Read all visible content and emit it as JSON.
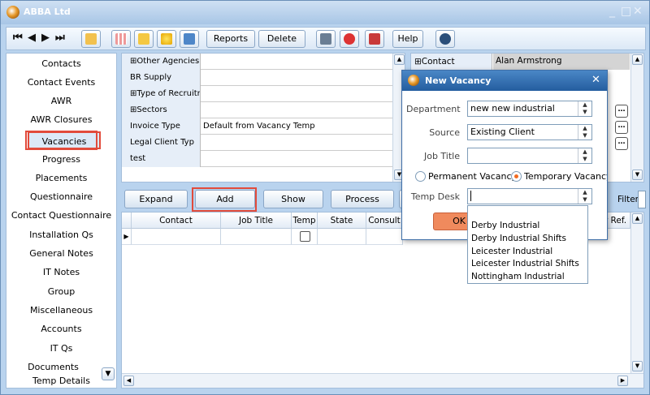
{
  "window": {
    "title": "ABBA Ltd",
    "controls": [
      "_",
      "□",
      "✕"
    ]
  },
  "toolbar": {
    "nav": [
      "⏮",
      "◀",
      "▶",
      "⏭"
    ],
    "reports_label": "Reports",
    "delete_label": "Delete",
    "help_label": "Help"
  },
  "sidebar": {
    "items": [
      "Contacts",
      "Contact Events",
      "AWR",
      "AWR Closures",
      "Vacancies",
      "Progress",
      "Placements",
      "Questionnaire",
      "Contact Questionnaire",
      "Installation Qs",
      "General Notes",
      "IT Notes",
      "Group",
      "Miscellaneous",
      "Accounts",
      "IT Qs",
      "Documents",
      "Temp Details"
    ],
    "selected": "Vacancies"
  },
  "tree": {
    "rows": [
      {
        "label": "⊞Other Agencies",
        "value": ""
      },
      {
        "label": "BR Supply",
        "value": ""
      },
      {
        "label": "⊞Type of Recruitm",
        "value": ""
      },
      {
        "label": "⊞Sectors",
        "value": ""
      },
      {
        "label": "Invoice Type",
        "value": "Default from Vacancy Temp"
      },
      {
        "label": "Legal Client Typ",
        "value": ""
      },
      {
        "label": "test",
        "value": ""
      }
    ]
  },
  "right_panel": {
    "contact_label": "⊞Contact",
    "contact_value": "Alan Armstrong"
  },
  "buttons": {
    "expand": "Expand",
    "add": "Add",
    "show_historic": "Show Historic",
    "process": "Process",
    "filter": "Filter"
  },
  "grid": {
    "columns": [
      "Contact",
      "Job Title",
      "Temp",
      "State",
      "Consult",
      "r Ref."
    ]
  },
  "dialog": {
    "title": "New Vacancy",
    "department_label": "Department",
    "department_value": "new new industrial",
    "source_label": "Source",
    "source_value": "Existing Client",
    "job_title_label": "Job Title",
    "job_title_value": "",
    "permanent_label": "Permanent Vacancy",
    "temporary_label": "Temporary Vacancy",
    "temp_desk_label": "Temp Desk",
    "temp_desk_value": "",
    "ok_label": "OK",
    "close": "✕"
  },
  "temp_desk_options": [
    "Derby Industrial",
    "Derby Industrial Shifts",
    "Leicester Industrial",
    "Leicester Industrial Shifts",
    "Nottingham Industrial"
  ],
  "colors": {
    "highlight": "#e24b3b",
    "ok_button": "#f08a5d",
    "radio_selected": "#f26b21"
  }
}
